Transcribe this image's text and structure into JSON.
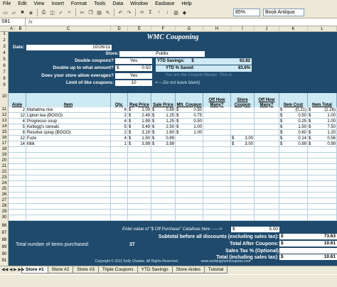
{
  "menu": [
    "File",
    "Edit",
    "View",
    "Insert",
    "Format",
    "Tools",
    "Data",
    "Window",
    "Easbase",
    "Help"
  ],
  "toolbar": {
    "zoom": "85%",
    "font": "Book Antiqua"
  },
  "formula": {
    "cell": "S81",
    "fx": "fx"
  },
  "columns": [
    "A",
    "B",
    "C",
    "D",
    "E",
    "F",
    "G",
    "H",
    "I",
    "J",
    "K",
    "L"
  ],
  "row_numbers": [
    "1",
    "2",
    "3",
    "4",
    "5",
    "6",
    "7",
    "8",
    "9",
    "10",
    "11",
    "12",
    "13",
    "14",
    "15",
    "16",
    "17",
    "18",
    "19",
    "20",
    "21",
    "22",
    "23",
    "24",
    "25",
    "26",
    "27",
    "28",
    "29",
    "30",
    "86",
    "87",
    "88",
    "89",
    "90",
    "91"
  ],
  "sheet": {
    "title": "WMC Couponing",
    "date_label": "Date:",
    "date_value": "10/26/11",
    "store_label": "Store:",
    "store_value": "Publix",
    "double_label": "Double coupons?",
    "double_value": "Yes",
    "double_upto_label": "Double up to what amount?",
    "double_upto_cur": "$",
    "double_upto_value": "0.50",
    "overage_label": "Does your store allow overages?",
    "overage_value": "Yes",
    "limit_label": "Limit of like coupons:",
    "limit_value": "10",
    "limit_note": "<----Do not leave blank)",
    "ytd_savings_label": "YTD Savings:",
    "ytd_savings_cur": "$",
    "ytd_savings_value": "62.82",
    "ytd_pct_label": "YTD % Saved:",
    "ytd_pct_value": "83.6%",
    "matcher_note": "You are the Coupon Master. This is",
    "headers": [
      "Aisle",
      "Item",
      "Qty.",
      "Reg Price",
      "Sale Price",
      "Mfr. Coupon",
      "Off How Many?",
      "Store Coupon",
      "Off How Many?",
      "Item Cost",
      "Item Total"
    ],
    "items": [
      {
        "aisle": "2",
        "item": "Mahatma rice",
        "qty": "6",
        "reg": "1.09",
        "sale": "0.89",
        "mfr": "0.50",
        "store": "",
        "cost": "(0.21)",
        "total": "(1.26)"
      },
      {
        "aisle": "12",
        "item": "Lipton tea (BOGO)",
        "qty": "2",
        "reg": "2.49",
        "sale": "1.25",
        "mfr": "0.75",
        "store": "",
        "cost": "0.50",
        "total": "1.00"
      },
      {
        "aisle": "4",
        "item": "Progresso soup",
        "qty": "4",
        "reg": "1.99",
        "sale": "1.25",
        "mfr": "0.50",
        "store": "",
        "cost": "0.25",
        "total": "1.00"
      },
      {
        "aisle": "5",
        "item": "Kellogg's cereals",
        "qty": "5",
        "reg": "3.49",
        "sale": "2.50",
        "mfr": "1.00",
        "store": "",
        "cost": "1.50",
        "total": "7.50"
      },
      {
        "aisle": "8",
        "item": "Resolve spray (BOGO)",
        "qty": "2",
        "reg": "3.19",
        "sale": "1.60",
        "mfr": "1.00",
        "store": "",
        "cost": "0.60",
        "total": "1.20"
      },
      {
        "aisle": "12",
        "item": "Fuze",
        "qty": "4",
        "reg": "1.50",
        "sale": "0.89",
        "mfr": "",
        "store": "3.00",
        "cost": "0.14",
        "total": "0.56"
      },
      {
        "aisle": "14",
        "item": "Milk",
        "qty": "1",
        "reg": "3.99",
        "sale": "3.99",
        "mfr": "",
        "store": "3.00",
        "cost": "0.99",
        "total": "0.99"
      }
    ],
    "dollar": "$",
    "catalina_note": "Enter value of \"$ Off Purchase\" Catalinas here ------>",
    "catalina_cur": "$",
    "catalina_value": "5.00",
    "subtotal_label": "Subtotal before all discounts (excluding sales tax):",
    "subtotal_value": "73.63",
    "after_label": "Total After Coupons:",
    "after_value": "10.61",
    "tax_label": "Sales Tax % (Optional)",
    "total_label": "Total (including sales tax):",
    "total_value": "10.61",
    "count_label": "Total number of items purchased:",
    "count_value": "37",
    "copyright": "Copyright © 2011 Kelly Chadee. All Rights Reserved.",
    "site": "www.workingmomcoupons.com"
  },
  "tabs": [
    "Store #1",
    "Store #2",
    "Store #3",
    "Triple Coupons",
    "YTD Savings",
    "Store Aisles",
    "Tutorial"
  ]
}
